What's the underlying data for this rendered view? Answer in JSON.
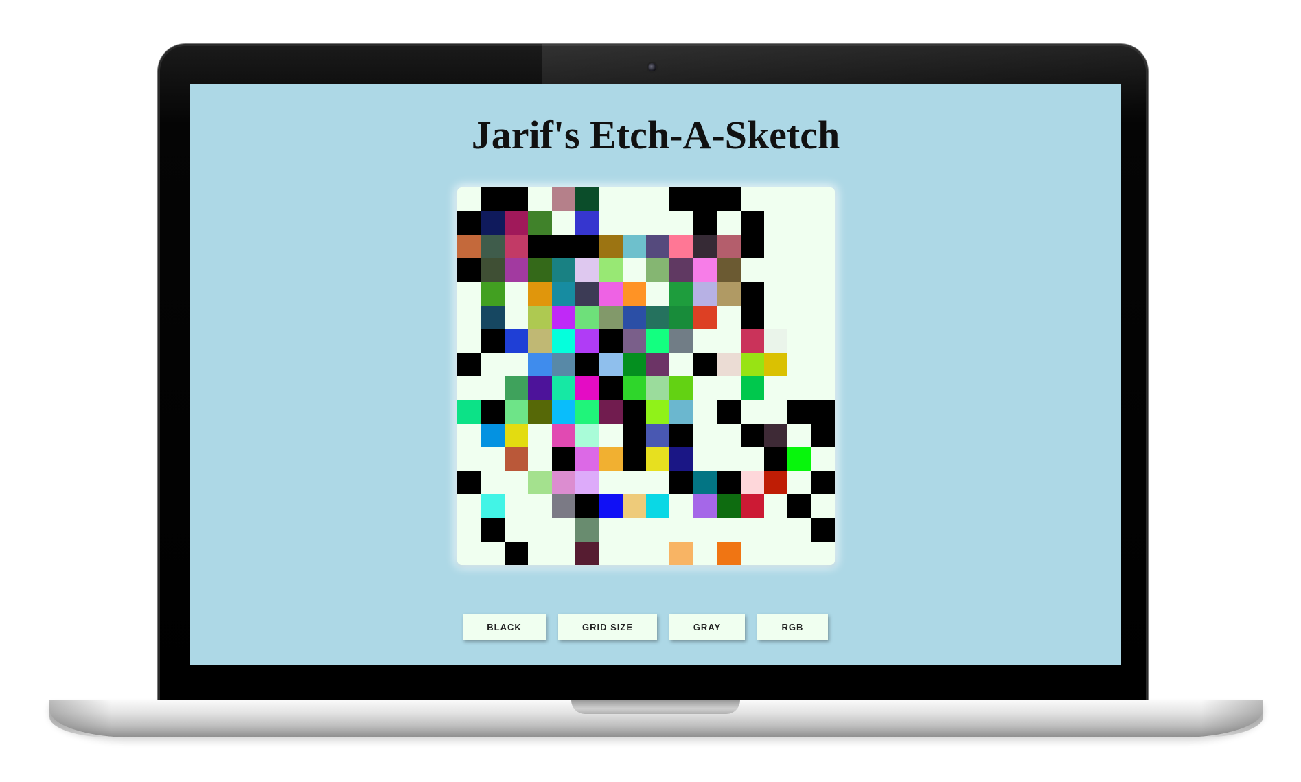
{
  "app": {
    "title": "Jarif's Etch-A-Sketch"
  },
  "buttons": {
    "black": "BLACK",
    "grid_size": "GRID SIZE",
    "gray": "GRAY",
    "rgb": "RGB"
  },
  "grid": {
    "size": 16,
    "background_color": "#f0fff0",
    "cells": [
      [
        "",
        "#000000",
        "#000000",
        "",
        "#b5808a",
        "#0b4d2a",
        "",
        "",
        "",
        "#000000",
        "#000000",
        "#000000",
        "",
        "",
        "",
        ""
      ],
      [
        "#000000",
        "#0f1a5c",
        "#a0195a",
        "#40822a",
        "",
        "#3636cf",
        "",
        "",
        "",
        "",
        "#000000",
        "",
        "#000000",
        "",
        "",
        ""
      ],
      [
        "#c4693b",
        "#3f5c4b",
        "#c23a66",
        "#000000",
        "#000000",
        "#000000",
        "#9c7412",
        "#6ec0cc",
        "#554a7d",
        "#ff7795",
        "#362a35",
        "#b45e6c",
        "#000000",
        "",
        "",
        ""
      ],
      [
        "#000000",
        "#3f4f34",
        "#a23aa0",
        "#346919",
        "#198183",
        "#dec8ef",
        "#98e874",
        "",
        "#85b672",
        "#603962",
        "#f77de8",
        "#6b5a32",
        "",
        "",
        "",
        ""
      ],
      [
        "",
        "#42a021",
        "",
        "#e0960c",
        "#178ca1",
        "#3c3b55",
        "#ee62e4",
        "#ff9325",
        "",
        "#1e9d3d",
        "#b7b1e4",
        "#b09a64",
        "#000000",
        "",
        "",
        ""
      ],
      [
        "",
        "#164761",
        "",
        "#aec951",
        "#c029f7",
        "#6ee07a",
        "#82996a",
        "#2b4fa6",
        "#25725e",
        "#188c3a",
        "#dd4024",
        "",
        "#000000",
        "",
        "",
        ""
      ],
      [
        "",
        "#000000",
        "#1f3fd6",
        "#c0b874",
        "#05ffdc",
        "#b03cf6",
        "#000000",
        "#7a5f8a",
        "#13ff80",
        "#717d86",
        "",
        "",
        "#ca335a",
        "#eaf4ea",
        "",
        ""
      ],
      [
        "#000000",
        "",
        "",
        "#3f8ced",
        "#5889a7",
        "#000000",
        "#8fbfed",
        "#048f1f",
        "#6c3466",
        "",
        "#000000",
        "#ebdcd4",
        "#98e314",
        "#dac102",
        "",
        ""
      ],
      [
        "",
        "",
        "#3fa25c",
        "#4d139a",
        "#16e8a4",
        "#e40cc4",
        "#000000",
        "#2fd62b",
        "#9bdc9c",
        "#63d213",
        "",
        "",
        "#00c84d",
        "",
        "",
        ""
      ],
      [
        "#0ce287",
        "#000000",
        "#6ee488",
        "#566807",
        "#0abdfb",
        "#20f47a",
        "#711c4f",
        "#000000",
        "#90f219",
        "#6bb7cf",
        "",
        "#000000",
        "",
        "",
        "#000000",
        "#000000"
      ],
      [
        "",
        "#0492e1",
        "#e3dc11",
        "",
        "#e14ab2",
        "#a9fcd8",
        "",
        "#000000",
        "#4958b2",
        "#000000",
        "",
        "",
        "#000000",
        "#3e2a36",
        "",
        "#000000"
      ],
      [
        "",
        "",
        "#ba5839",
        "",
        "#000000",
        "#dc69e6",
        "#f1b031",
        "#000000",
        "#e7e01f",
        "#1a1685",
        "",
        "",
        "",
        "#000000",
        "#07f60c",
        ""
      ],
      [
        "#000000",
        "",
        "",
        "#a4e18e",
        "#dc8dd0",
        "#ddabfa",
        "",
        "",
        "",
        "#000000",
        "#037584",
        "#000000",
        "#fed7da",
        "#bf1d05",
        "",
        "#000000"
      ],
      [
        "",
        "#42f4e6",
        "",
        "",
        "#7b7a85",
        "#000000",
        "#1010f5",
        "#eecb7a",
        "#0ad8e5",
        "",
        "#a567e8",
        "#0e6c10",
        "#cc1a34",
        "",
        "#000000",
        ""
      ],
      [
        "",
        "#000000",
        "",
        "",
        "",
        "#698c6f",
        "",
        "",
        "",
        "",
        "",
        "",
        "",
        "",
        "",
        "#000000"
      ],
      [
        "",
        "",
        "#000000",
        "",
        "",
        "#561c31",
        "",
        "",
        "",
        "#f8b464",
        "",
        "#f07513",
        "",
        "",
        "",
        ""
      ]
    ]
  }
}
